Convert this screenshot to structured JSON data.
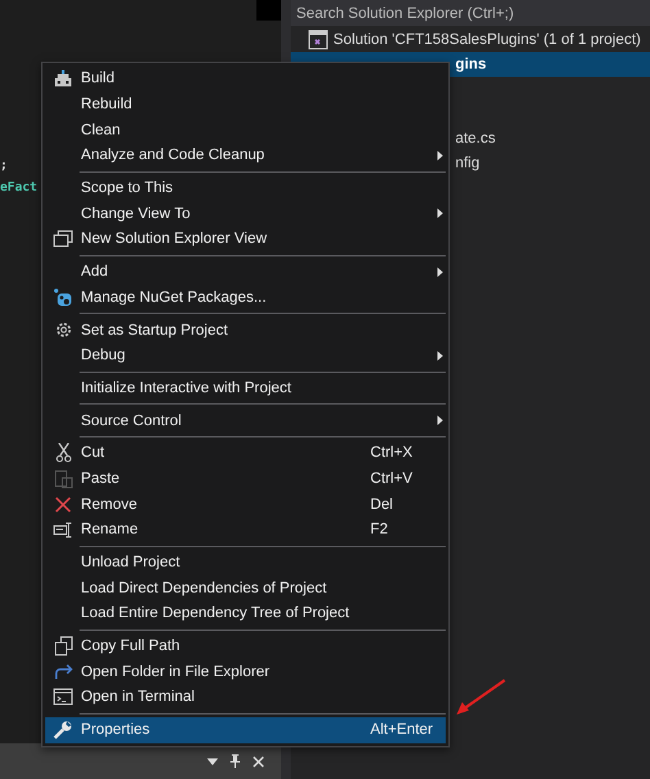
{
  "editor": {
    "fragments": [
      ";",
      "eFact"
    ]
  },
  "solution_explorer": {
    "search": {
      "placeholder": "Search Solution Explorer (Ctrl+;)"
    },
    "items": [
      {
        "label": "Solution 'CFT158SalesPlugins' (1 of 1 project)",
        "selected": false
      },
      {
        "label": "gins",
        "selected": true
      },
      {
        "label": "ate.cs",
        "selected": false
      },
      {
        "label": "nfig",
        "selected": false
      }
    ]
  },
  "context_menu": {
    "groups": [
      [
        {
          "label": "Build",
          "submenu": false,
          "selected": false
        },
        {
          "label": "Rebuild",
          "submenu": false,
          "selected": false
        },
        {
          "label": "Clean",
          "submenu": false,
          "selected": false
        },
        {
          "label": "Analyze and Code Cleanup",
          "submenu": true,
          "selected": false
        }
      ],
      [
        {
          "label": "Scope to This",
          "submenu": false,
          "selected": false
        },
        {
          "label": "Change View To",
          "submenu": true,
          "selected": false
        },
        {
          "label": "New Solution Explorer View",
          "submenu": false,
          "selected": false
        }
      ],
      [
        {
          "label": "Add",
          "submenu": true,
          "selected": false
        },
        {
          "label": "Manage NuGet Packages...",
          "submenu": false,
          "selected": false
        }
      ],
      [
        {
          "label": "Set as Startup Project",
          "submenu": false,
          "selected": false
        },
        {
          "label": "Debug",
          "submenu": true,
          "selected": false
        }
      ],
      [
        {
          "label": "Initialize Interactive with Project",
          "submenu": false,
          "selected": false
        }
      ],
      [
        {
          "label": "Source Control",
          "submenu": true,
          "selected": false
        }
      ],
      [
        {
          "label": "Cut",
          "shortcut": "Ctrl+X",
          "submenu": false,
          "selected": false
        },
        {
          "label": "Paste",
          "shortcut": "Ctrl+V",
          "submenu": false,
          "selected": false
        },
        {
          "label": "Remove",
          "shortcut": "Del",
          "submenu": false,
          "selected": false
        },
        {
          "label": "Rename",
          "shortcut": "F2",
          "submenu": false,
          "selected": false
        }
      ],
      [
        {
          "label": "Unload Project",
          "submenu": false,
          "selected": false
        },
        {
          "label": "Load Direct Dependencies of Project",
          "submenu": false,
          "selected": false
        },
        {
          "label": "Load Entire Dependency Tree of Project",
          "submenu": false,
          "selected": false
        }
      ],
      [
        {
          "label": "Copy Full Path",
          "submenu": false,
          "selected": false
        },
        {
          "label": "Open Folder in File Explorer",
          "submenu": false,
          "selected": false
        },
        {
          "label": "Open in Terminal",
          "submenu": false,
          "selected": false
        }
      ],
      [
        {
          "label": "Properties",
          "shortcut": "Alt+Enter",
          "submenu": false,
          "selected": true
        }
      ]
    ]
  }
}
